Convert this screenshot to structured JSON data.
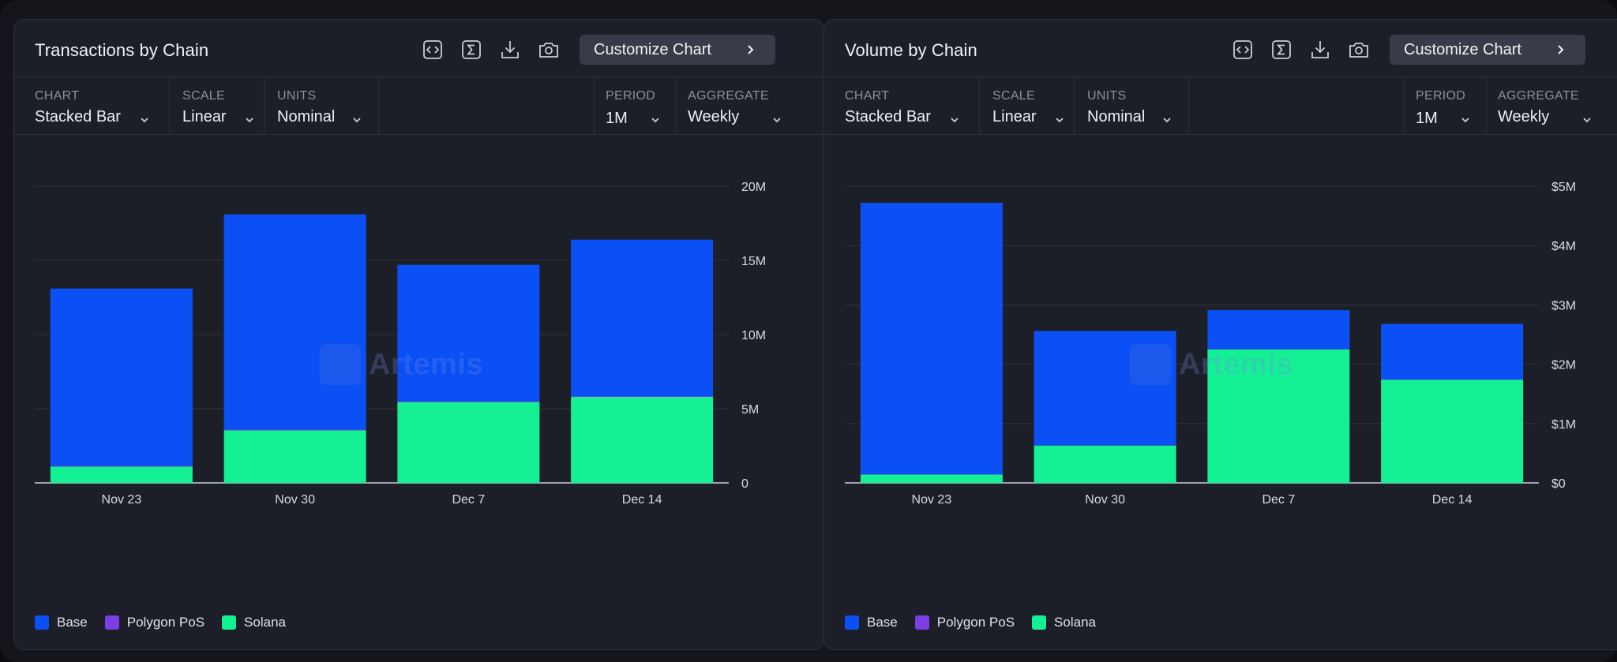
{
  "panels": [
    {
      "title": "Transactions by Chain",
      "toolbar": {
        "customize_label": "Customize Chart",
        "icons": [
          "embed-icon",
          "sum-icon",
          "download-icon",
          "camera-icon"
        ]
      },
      "controls": {
        "chart": {
          "label": "CHART",
          "value": "Stacked Bar"
        },
        "scale": {
          "label": "SCALE",
          "value": "Linear"
        },
        "units": {
          "label": "UNITS",
          "value": "Nominal"
        },
        "period": {
          "label": "PERIOD",
          "value": "1M"
        },
        "aggregate": {
          "label": "AGGREGATE",
          "value": "Weekly"
        }
      },
      "watermark": "Artemis",
      "legend": [
        {
          "name": "Base",
          "color": "#0b50f5"
        },
        {
          "name": "Polygon PoS",
          "color": "#7b3fe4"
        },
        {
          "name": "Solana",
          "color": "#14f195"
        }
      ],
      "chart_data": {
        "type": "bar",
        "stacked": true,
        "categories": [
          "Nov 23",
          "Nov 30",
          "Dec 7",
          "Dec 14"
        ],
        "series": [
          {
            "name": "Solana",
            "color": "#14f195",
            "values": [
              1100000,
              3550000,
              5450000,
              5800000
            ]
          },
          {
            "name": "Polygon PoS",
            "color": "#7b3fe4",
            "values": [
              50000,
              50000,
              50000,
              50000
            ]
          },
          {
            "name": "Base",
            "color": "#0b50f5",
            "values": [
              11950000,
              14500000,
              9200000,
              10550000
            ]
          }
        ],
        "ylim": [
          0,
          20000000
        ],
        "yticks": [
          0,
          5000000,
          10000000,
          15000000,
          20000000
        ],
        "ytick_labels": [
          "0",
          "5M",
          "10M",
          "15M",
          "20M"
        ],
        "grid": true,
        "legend_position": "bottom-left"
      }
    },
    {
      "title": "Volume by Chain",
      "toolbar": {
        "customize_label": "Customize Chart",
        "icons": [
          "embed-icon",
          "sum-icon",
          "download-icon",
          "camera-icon"
        ]
      },
      "controls": {
        "chart": {
          "label": "CHART",
          "value": "Stacked Bar"
        },
        "scale": {
          "label": "SCALE",
          "value": "Linear"
        },
        "units": {
          "label": "UNITS",
          "value": "Nominal"
        },
        "period": {
          "label": "PERIOD",
          "value": "1M"
        },
        "aggregate": {
          "label": "AGGREGATE",
          "value": "Weekly"
        }
      },
      "watermark": "Artemis",
      "legend": [
        {
          "name": "Base",
          "color": "#0b50f5"
        },
        {
          "name": "Polygon PoS",
          "color": "#7b3fe4"
        },
        {
          "name": "Solana",
          "color": "#14f195"
        }
      ],
      "chart_data": {
        "type": "bar",
        "stacked": true,
        "categories": [
          "Nov 23",
          "Nov 30",
          "Dec 7",
          "Dec 14"
        ],
        "series": [
          {
            "name": "Solana",
            "color": "#14f195",
            "values": [
              140000,
              630000,
              2250000,
              1740000
            ]
          },
          {
            "name": "Polygon PoS",
            "color": "#7b3fe4",
            "values": [
              5000,
              5000,
              5000,
              5000
            ]
          },
          {
            "name": "Base",
            "color": "#0b50f5",
            "values": [
              4575000,
              1925000,
              655000,
              935000
            ]
          }
        ],
        "ylim": [
          0,
          5000000
        ],
        "yticks": [
          0,
          1000000,
          2000000,
          3000000,
          4000000,
          5000000
        ],
        "ytick_labels": [
          "$0",
          "$1M",
          "$2M",
          "$3M",
          "$4M",
          "$5M"
        ],
        "grid": true,
        "legend_position": "bottom-left"
      }
    }
  ]
}
